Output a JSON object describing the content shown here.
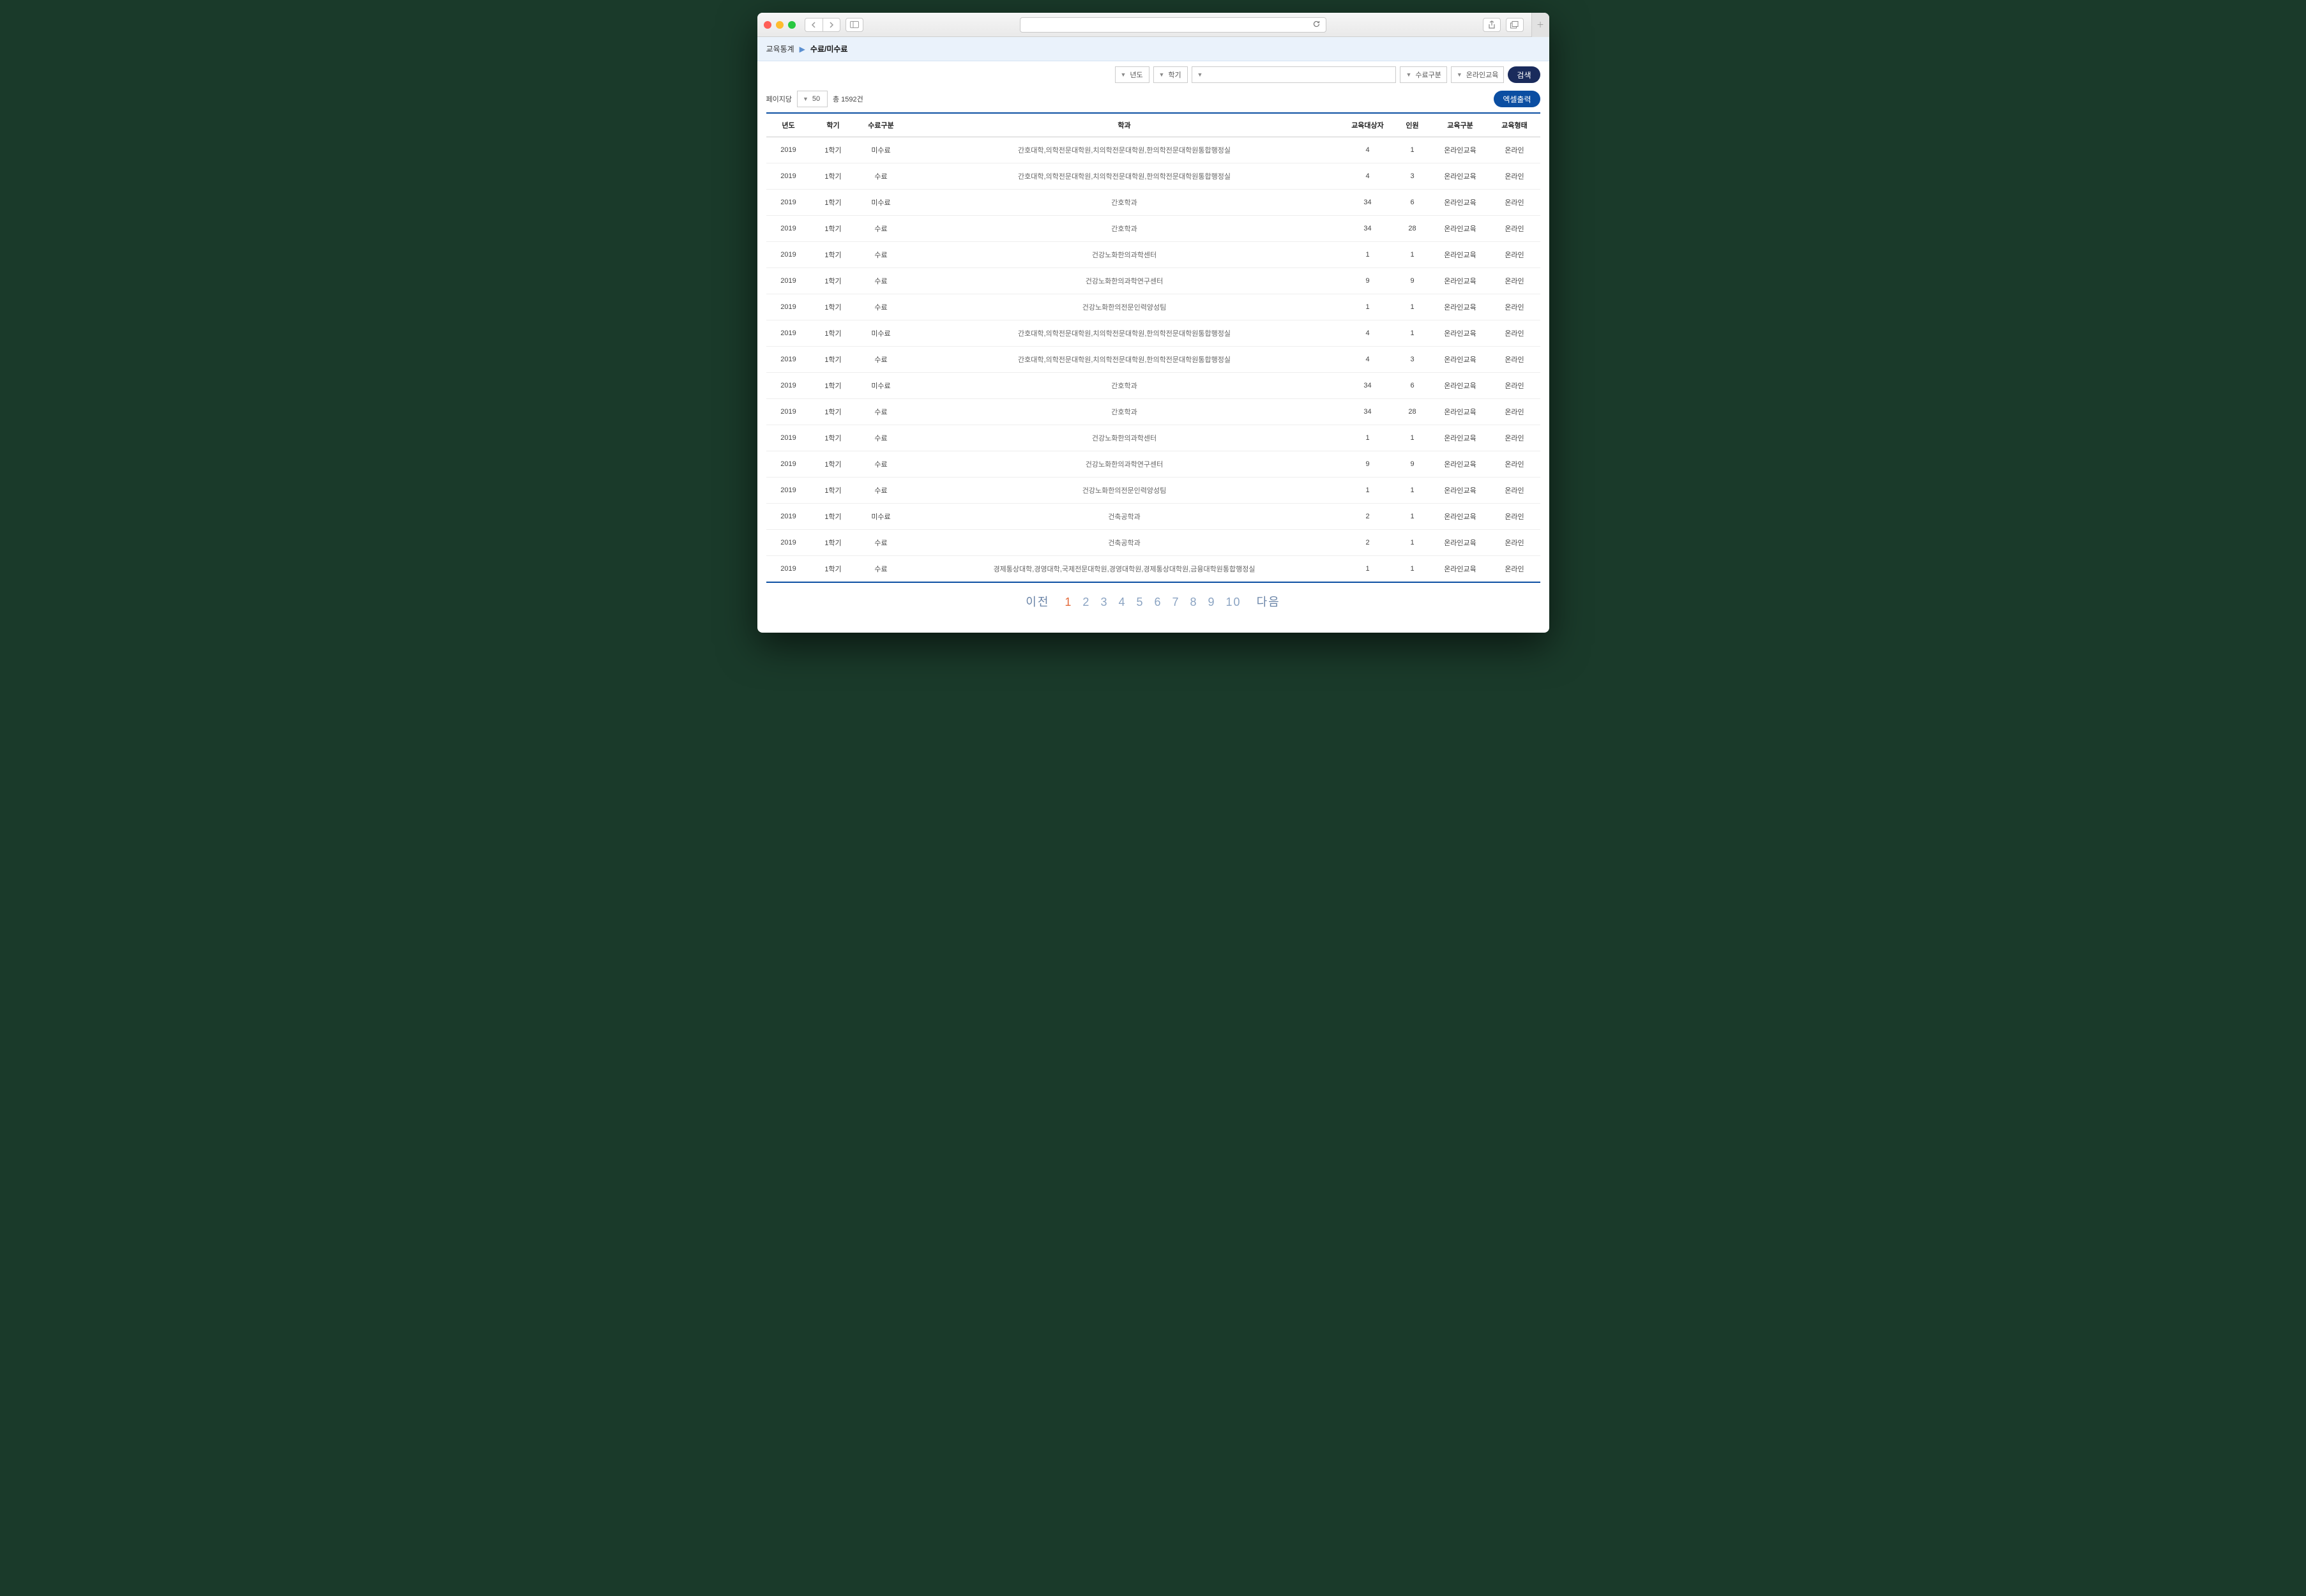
{
  "breadcrumb": {
    "root": "교육통계",
    "current": "수료/미수료"
  },
  "filters": {
    "year_label": "년도",
    "semester_label": "학기",
    "status_label": "수료구분",
    "edu_label": "온라인교육",
    "search_btn": "검색"
  },
  "meta": {
    "per_page_label": "페이지당",
    "per_page_value": "50",
    "total_text": "총 1592건",
    "excel_btn": "엑셀출력"
  },
  "table": {
    "headers": {
      "year": "년도",
      "semester": "학기",
      "status": "수료구분",
      "dept": "학과",
      "target": "교육대상자",
      "count": "인원",
      "category": "교육구분",
      "type": "교육형태"
    },
    "rows": [
      {
        "year": "2019",
        "sem": "1학기",
        "stat": "미수료",
        "dept": "간호대학,의학전문대학원,치의학전문대학원,한의학전문대학원통합행정실",
        "tgt": "4",
        "cnt": "1",
        "cat": "온라인교육",
        "type": "온라인"
      },
      {
        "year": "2019",
        "sem": "1학기",
        "stat": "수료",
        "dept": "간호대학,의학전문대학원,치의학전문대학원,한의학전문대학원통합행정실",
        "tgt": "4",
        "cnt": "3",
        "cat": "온라인교육",
        "type": "온라인"
      },
      {
        "year": "2019",
        "sem": "1학기",
        "stat": "미수료",
        "dept": "간호학과",
        "tgt": "34",
        "cnt": "6",
        "cat": "온라인교육",
        "type": "온라인"
      },
      {
        "year": "2019",
        "sem": "1학기",
        "stat": "수료",
        "dept": "간호학과",
        "tgt": "34",
        "cnt": "28",
        "cat": "온라인교육",
        "type": "온라인"
      },
      {
        "year": "2019",
        "sem": "1학기",
        "stat": "수료",
        "dept": "건강노화한의과학센터",
        "tgt": "1",
        "cnt": "1",
        "cat": "온라인교육",
        "type": "온라인"
      },
      {
        "year": "2019",
        "sem": "1학기",
        "stat": "수료",
        "dept": "건강노화한의과학연구센터",
        "tgt": "9",
        "cnt": "9",
        "cat": "온라인교육",
        "type": "온라인"
      },
      {
        "year": "2019",
        "sem": "1학기",
        "stat": "수료",
        "dept": "건강노화한의전문인력양성팀",
        "tgt": "1",
        "cnt": "1",
        "cat": "온라인교육",
        "type": "온라인"
      },
      {
        "year": "2019",
        "sem": "1학기",
        "stat": "미수료",
        "dept": "간호대학,의학전문대학원,치의학전문대학원,한의학전문대학원통합행정실",
        "tgt": "4",
        "cnt": "1",
        "cat": "온라인교육",
        "type": "온라인"
      },
      {
        "year": "2019",
        "sem": "1학기",
        "stat": "수료",
        "dept": "간호대학,의학전문대학원,치의학전문대학원,한의학전문대학원통합행정실",
        "tgt": "4",
        "cnt": "3",
        "cat": "온라인교육",
        "type": "온라인"
      },
      {
        "year": "2019",
        "sem": "1학기",
        "stat": "미수료",
        "dept": "간호학과",
        "tgt": "34",
        "cnt": "6",
        "cat": "온라인교육",
        "type": "온라인"
      },
      {
        "year": "2019",
        "sem": "1학기",
        "stat": "수료",
        "dept": "간호학과",
        "tgt": "34",
        "cnt": "28",
        "cat": "온라인교육",
        "type": "온라인"
      },
      {
        "year": "2019",
        "sem": "1학기",
        "stat": "수료",
        "dept": "건강노화한의과학센터",
        "tgt": "1",
        "cnt": "1",
        "cat": "온라인교육",
        "type": "온라인"
      },
      {
        "year": "2019",
        "sem": "1학기",
        "stat": "수료",
        "dept": "건강노화한의과학연구센터",
        "tgt": "9",
        "cnt": "9",
        "cat": "온라인교육",
        "type": "온라인"
      },
      {
        "year": "2019",
        "sem": "1학기",
        "stat": "수료",
        "dept": "건강노화한의전문인력양성팀",
        "tgt": "1",
        "cnt": "1",
        "cat": "온라인교육",
        "type": "온라인"
      },
      {
        "year": "2019",
        "sem": "1학기",
        "stat": "미수료",
        "dept": "건축공학과",
        "tgt": "2",
        "cnt": "1",
        "cat": "온라인교육",
        "type": "온라인"
      },
      {
        "year": "2019",
        "sem": "1학기",
        "stat": "수료",
        "dept": "건축공학과",
        "tgt": "2",
        "cnt": "1",
        "cat": "온라인교육",
        "type": "온라인"
      },
      {
        "year": "2019",
        "sem": "1학기",
        "stat": "수료",
        "dept": "경제통상대학,경영대학,국제전문대학원,경영대학원,경제통상대학원,금융대학원통합행정실",
        "tgt": "1",
        "cnt": "1",
        "cat": "온라인교육",
        "type": "온라인"
      }
    ]
  },
  "pager": {
    "prev": "이전",
    "next": "다음",
    "pages": [
      "1",
      "2",
      "3",
      "4",
      "5",
      "6",
      "7",
      "8",
      "9",
      "10"
    ],
    "current": "1"
  }
}
